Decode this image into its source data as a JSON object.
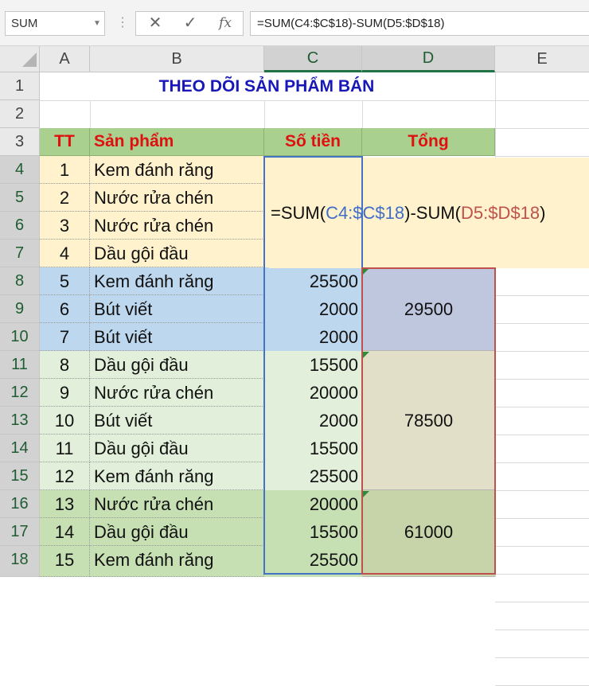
{
  "formula_bar": {
    "name_box": "SUM",
    "cancel_icon": "✕",
    "enter_icon": "✓",
    "fx_label": "fx",
    "formula": "=SUM(C4:$C$18)-SUM(D5:$D$18)"
  },
  "editor": {
    "prefix": "=SUM(",
    "ref1": "C4:$C$18",
    "middle": ")-SUM(",
    "ref2": "D5:$D$18",
    "suffix": ")"
  },
  "columns": [
    "A",
    "B",
    "C",
    "D",
    "E"
  ],
  "row_numbers": [
    "1",
    "2",
    "3",
    "4",
    "5",
    "6",
    "7",
    "8",
    "9",
    "10",
    "11",
    "12",
    "13",
    "14",
    "15",
    "16",
    "17",
    "18"
  ],
  "title": "THEO DÕI SẢN PHẨM BÁN",
  "headers": {
    "tt": "TT",
    "product": "Sản phẩm",
    "amount": "Số tiền",
    "total": "Tổng"
  },
  "rows": [
    {
      "tt": "1",
      "product": "Kem đánh răng",
      "amount": ""
    },
    {
      "tt": "2",
      "product": "Nước rửa chén",
      "amount": ""
    },
    {
      "tt": "3",
      "product": "Nước rửa chén",
      "amount": ""
    },
    {
      "tt": "4",
      "product": "Dầu gội đầu",
      "amount": ""
    },
    {
      "tt": "5",
      "product": "Kem đánh răng",
      "amount": "25500"
    },
    {
      "tt": "6",
      "product": "Bút viết",
      "amount": "2000"
    },
    {
      "tt": "7",
      "product": "Bút viết",
      "amount": "2000"
    },
    {
      "tt": "8",
      "product": "Dầu gội đầu",
      "amount": "15500"
    },
    {
      "tt": "9",
      "product": "Nước rửa chén",
      "amount": "20000"
    },
    {
      "tt": "10",
      "product": "Bút viết",
      "amount": "2000"
    },
    {
      "tt": "11",
      "product": "Dầu gội đầu",
      "amount": "15500"
    },
    {
      "tt": "12",
      "product": "Kem đánh răng",
      "amount": "25500"
    },
    {
      "tt": "13",
      "product": "Nước rửa chén",
      "amount": "20000"
    },
    {
      "tt": "14",
      "product": "Dầu gội đầu",
      "amount": "15500"
    },
    {
      "tt": "15",
      "product": "Kem đánh răng",
      "amount": "25500"
    }
  ],
  "totals": [
    {
      "value": "29500",
      "color": "#bfc7df"
    },
    {
      "value": "78500",
      "color": "#e2dfc9"
    },
    {
      "value": "61000",
      "color": "#c7d3a9"
    }
  ],
  "row_colors": [
    "#fff2cc",
    "#bdd7ee",
    "#e2efda",
    "#c6e0b4"
  ]
}
